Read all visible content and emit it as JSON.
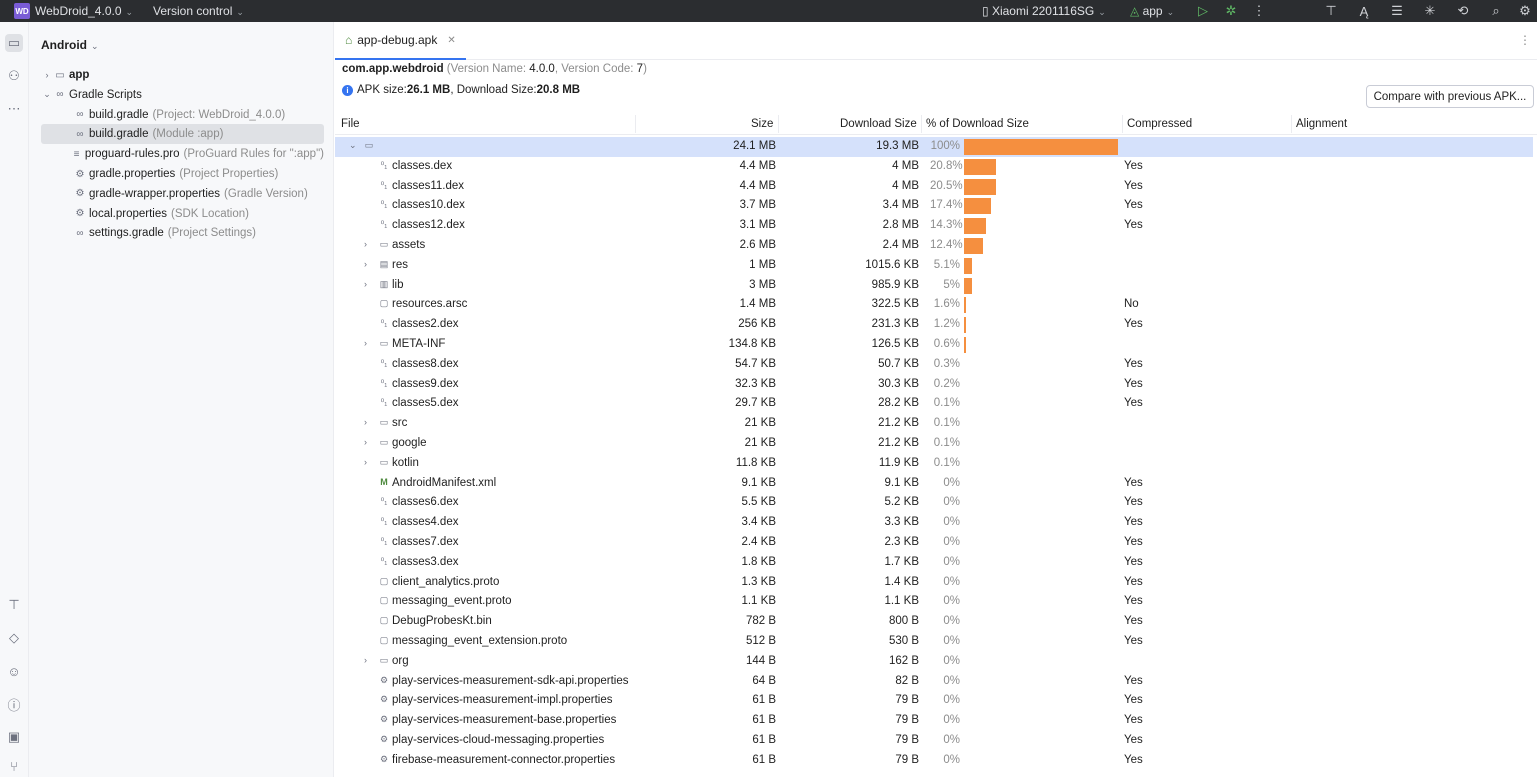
{
  "titlebar": {
    "logo": "WD",
    "project": "WebDroid_4.0.0",
    "version_control": "Version control",
    "device": "Xiaomi 2201116SG",
    "run_config": "app"
  },
  "project_panel": {
    "view": "Android",
    "items": [
      {
        "label": "app",
        "hint": "",
        "indent": 0,
        "arrow": "›",
        "icon": "folder-icon",
        "bold": true
      },
      {
        "label": "Gradle Scripts",
        "hint": "",
        "indent": 0,
        "arrow": "⌄",
        "icon": "gradle-icon",
        "bold": false
      },
      {
        "label": "build.gradle",
        "hint": "(Project: WebDroid_4.0.0)",
        "indent": 1,
        "arrow": "",
        "icon": "gradle-icon",
        "bold": false
      },
      {
        "label": "build.gradle",
        "hint": "(Module :app)",
        "indent": 1,
        "arrow": "",
        "icon": "gradle-icon",
        "bold": false,
        "selected": true
      },
      {
        "label": "proguard-rules.pro",
        "hint": "(ProGuard Rules for \":app\")",
        "indent": 1,
        "arrow": "",
        "icon": "text-icon",
        "bold": false
      },
      {
        "label": "gradle.properties",
        "hint": "(Project Properties)",
        "indent": 1,
        "arrow": "",
        "icon": "settings-icon",
        "bold": false
      },
      {
        "label": "gradle-wrapper.properties",
        "hint": "(Gradle Version)",
        "indent": 1,
        "arrow": "",
        "icon": "settings-icon",
        "bold": false
      },
      {
        "label": "local.properties",
        "hint": "(SDK Location)",
        "indent": 1,
        "arrow": "",
        "icon": "settings-icon",
        "bold": false
      },
      {
        "label": "settings.gradle",
        "hint": "(Project Settings)",
        "indent": 1,
        "arrow": "",
        "icon": "gradle-icon",
        "bold": false
      }
    ]
  },
  "editor": {
    "tab": "app-debug.apk",
    "package": "com.app.webdroid",
    "version_info_prefix": "(Version Name: ",
    "version_name": "4.0.0",
    "version_info_mid": ", Version Code: ",
    "version_code": "7",
    "version_info_suffix": ")",
    "apk_size_label": "APK size: ",
    "apk_size": "26.1 MB",
    "download_size_label": ", Download Size: ",
    "download_size": "20.8 MB",
    "compare_button": "Compare with previous APK...",
    "columns": {
      "file": "File",
      "size": "Size",
      "download_size": "Download Size",
      "pct": "% of Download Size",
      "compressed": "Compressed",
      "alignment": "Alignment"
    },
    "rows": [
      {
        "name": "",
        "size": "24.1 MB",
        "dl": "19.3 MB",
        "pct": "100%",
        "pct_value": 100,
        "compressed": "",
        "icon": "folder-icon",
        "expand": "⌄",
        "level": 0,
        "selected": true
      },
      {
        "name": "classes.dex",
        "size": "4.4 MB",
        "dl": "4 MB",
        "pct": "20.8%",
        "pct_value": 20.8,
        "compressed": "Yes",
        "icon": "dex-icon",
        "expand": "",
        "level": 1
      },
      {
        "name": "classes11.dex",
        "size": "4.4 MB",
        "dl": "4 MB",
        "pct": "20.5%",
        "pct_value": 20.5,
        "compressed": "Yes",
        "icon": "dex-icon",
        "expand": "",
        "level": 1
      },
      {
        "name": "classes10.dex",
        "size": "3.7 MB",
        "dl": "3.4 MB",
        "pct": "17.4%",
        "pct_value": 17.4,
        "compressed": "Yes",
        "icon": "dex-icon",
        "expand": "",
        "level": 1
      },
      {
        "name": "classes12.dex",
        "size": "3.1 MB",
        "dl": "2.8 MB",
        "pct": "14.3%",
        "pct_value": 14.3,
        "compressed": "Yes",
        "icon": "dex-icon",
        "expand": "",
        "level": 1
      },
      {
        "name": "assets",
        "size": "2.6 MB",
        "dl": "2.4 MB",
        "pct": "12.4%",
        "pct_value": 12.4,
        "compressed": "",
        "icon": "folder-icon",
        "expand": "›",
        "level": 1
      },
      {
        "name": "res",
        "size": "1 MB",
        "dl": "1015.6 KB",
        "pct": "5.1%",
        "pct_value": 5.1,
        "compressed": "",
        "icon": "res-folder-icon",
        "expand": "›",
        "level": 1
      },
      {
        "name": "lib",
        "size": "3 MB",
        "dl": "985.9 KB",
        "pct": "5%",
        "pct_value": 5,
        "compressed": "",
        "icon": "lib-icon",
        "expand": "›",
        "level": 1
      },
      {
        "name": "resources.arsc",
        "size": "1.4 MB",
        "dl": "322.5 KB",
        "pct": "1.6%",
        "pct_value": 1.6,
        "compressed": "No",
        "icon": "unknown-file-icon",
        "expand": "",
        "level": 1
      },
      {
        "name": "classes2.dex",
        "size": "256 KB",
        "dl": "231.3 KB",
        "pct": "1.2%",
        "pct_value": 1.2,
        "compressed": "Yes",
        "icon": "dex-icon",
        "expand": "",
        "level": 1
      },
      {
        "name": "META-INF",
        "size": "134.8 KB",
        "dl": "126.5 KB",
        "pct": "0.6%",
        "pct_value": 0.6,
        "compressed": "",
        "icon": "folder-icon",
        "expand": "›",
        "level": 1
      },
      {
        "name": "classes8.dex",
        "size": "54.7 KB",
        "dl": "50.7 KB",
        "pct": "0.3%",
        "pct_value": 0,
        "compressed": "Yes",
        "icon": "dex-icon",
        "expand": "",
        "level": 1
      },
      {
        "name": "classes9.dex",
        "size": "32.3 KB",
        "dl": "30.3 KB",
        "pct": "0.2%",
        "pct_value": 0,
        "compressed": "Yes",
        "icon": "dex-icon",
        "expand": "",
        "level": 1
      },
      {
        "name": "classes5.dex",
        "size": "29.7 KB",
        "dl": "28.2 KB",
        "pct": "0.1%",
        "pct_value": 0,
        "compressed": "Yes",
        "icon": "dex-icon",
        "expand": "",
        "level": 1
      },
      {
        "name": "src",
        "size": "21 KB",
        "dl": "21.2 KB",
        "pct": "0.1%",
        "pct_value": 0,
        "compressed": "",
        "icon": "folder-icon",
        "expand": "›",
        "level": 1
      },
      {
        "name": "google",
        "size": "21 KB",
        "dl": "21.2 KB",
        "pct": "0.1%",
        "pct_value": 0,
        "compressed": "",
        "icon": "folder-icon",
        "expand": "›",
        "level": 1
      },
      {
        "name": "kotlin",
        "size": "11.8 KB",
        "dl": "11.9 KB",
        "pct": "0.1%",
        "pct_value": 0,
        "compressed": "",
        "icon": "folder-icon",
        "expand": "›",
        "level": 1
      },
      {
        "name": "AndroidManifest.xml",
        "size": "9.1 KB",
        "dl": "9.1 KB",
        "pct": "0%",
        "pct_value": 0,
        "compressed": "Yes",
        "icon": "manifest-icon",
        "expand": "",
        "level": 1
      },
      {
        "name": "classes6.dex",
        "size": "5.5 KB",
        "dl": "5.2 KB",
        "pct": "0%",
        "pct_value": 0,
        "compressed": "Yes",
        "icon": "dex-icon",
        "expand": "",
        "level": 1
      },
      {
        "name": "classes4.dex",
        "size": "3.4 KB",
        "dl": "3.3 KB",
        "pct": "0%",
        "pct_value": 0,
        "compressed": "Yes",
        "icon": "dex-icon",
        "expand": "",
        "level": 1
      },
      {
        "name": "classes7.dex",
        "size": "2.4 KB",
        "dl": "2.3 KB",
        "pct": "0%",
        "pct_value": 0,
        "compressed": "Yes",
        "icon": "dex-icon",
        "expand": "",
        "level": 1
      },
      {
        "name": "classes3.dex",
        "size": "1.8 KB",
        "dl": "1.7 KB",
        "pct": "0%",
        "pct_value": 0,
        "compressed": "Yes",
        "icon": "dex-icon",
        "expand": "",
        "level": 1
      },
      {
        "name": "client_analytics.proto",
        "size": "1.3 KB",
        "dl": "1.4 KB",
        "pct": "0%",
        "pct_value": 0,
        "compressed": "Yes",
        "icon": "unknown-file-icon",
        "expand": "",
        "level": 1
      },
      {
        "name": "messaging_event.proto",
        "size": "1.1 KB",
        "dl": "1.1 KB",
        "pct": "0%",
        "pct_value": 0,
        "compressed": "Yes",
        "icon": "unknown-file-icon",
        "expand": "",
        "level": 1
      },
      {
        "name": "DebugProbesKt.bin",
        "size": "782 B",
        "dl": "800 B",
        "pct": "0%",
        "pct_value": 0,
        "compressed": "Yes",
        "icon": "unknown-file-icon",
        "expand": "",
        "level": 1
      },
      {
        "name": "messaging_event_extension.proto",
        "size": "512 B",
        "dl": "530 B",
        "pct": "0%",
        "pct_value": 0,
        "compressed": "Yes",
        "icon": "unknown-file-icon",
        "expand": "",
        "level": 1
      },
      {
        "name": "org",
        "size": "144 B",
        "dl": "162 B",
        "pct": "0%",
        "pct_value": 0,
        "compressed": "",
        "icon": "folder-icon",
        "expand": "›",
        "level": 1
      },
      {
        "name": "play-services-measurement-sdk-api.properties",
        "size": "64 B",
        "dl": "82 B",
        "pct": "0%",
        "pct_value": 0,
        "compressed": "Yes",
        "icon": "settings-icon",
        "expand": "",
        "level": 1
      },
      {
        "name": "play-services-measurement-impl.properties",
        "size": "61 B",
        "dl": "79 B",
        "pct": "0%",
        "pct_value": 0,
        "compressed": "Yes",
        "icon": "settings-icon",
        "expand": "",
        "level": 1
      },
      {
        "name": "play-services-measurement-base.properties",
        "size": "61 B",
        "dl": "79 B",
        "pct": "0%",
        "pct_value": 0,
        "compressed": "Yes",
        "icon": "settings-icon",
        "expand": "",
        "level": 1
      },
      {
        "name": "play-services-cloud-messaging.properties",
        "size": "61 B",
        "dl": "79 B",
        "pct": "0%",
        "pct_value": 0,
        "compressed": "Yes",
        "icon": "settings-icon",
        "expand": "",
        "level": 1
      },
      {
        "name": "firebase-measurement-connector.properties",
        "size": "61 B",
        "dl": "79 B",
        "pct": "0%",
        "pct_value": 0,
        "compressed": "Yes",
        "icon": "settings-icon",
        "expand": "",
        "level": 1
      }
    ]
  },
  "colors": {
    "bar": "#f58f3f",
    "selection": "#d5e1fb",
    "accent": "#3574f0"
  }
}
